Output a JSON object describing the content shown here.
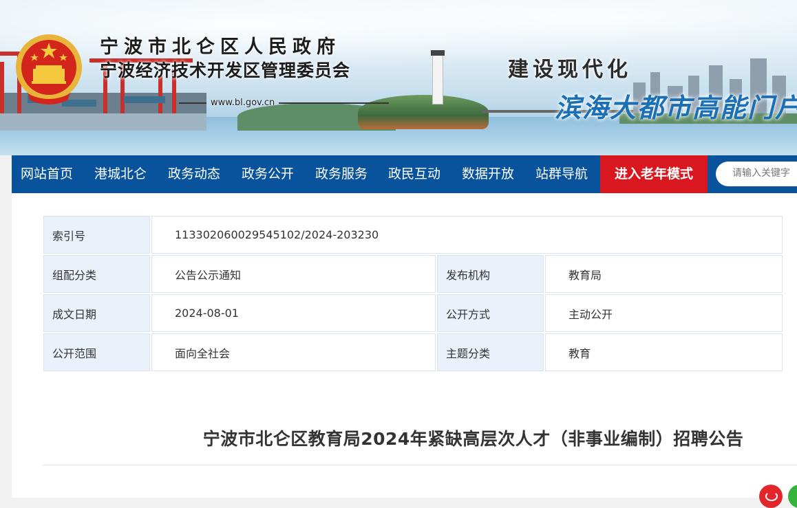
{
  "header": {
    "gov_title": "宁波市北仑区人民政府",
    "gov_subtitle": "宁波经济技术开发区管理委员会",
    "domain": "www.bl.gov.cn",
    "slogan_top": "建设现代化",
    "slogan_bottom": "滨海大都市高能门户",
    "emblem_icon": "national-emblem-icon"
  },
  "nav": {
    "items": [
      {
        "label": "网站首页"
      },
      {
        "label": "港城北仑"
      },
      {
        "label": "政务动态"
      },
      {
        "label": "政务公开"
      },
      {
        "label": "政务服务"
      },
      {
        "label": "政民互动"
      },
      {
        "label": "数据开放"
      },
      {
        "label": "站群导航"
      }
    ],
    "elder_mode": "进入老年模式",
    "search_placeholder": "请输入关键字"
  },
  "meta": {
    "index_label": "索引号",
    "index_value": "113302060029545102/2024-203230",
    "category_label": "组配分类",
    "category_value": "公告公示通知",
    "publisher_label": "发布机构",
    "publisher_value": "教育局",
    "date_label": "成文日期",
    "date_value": "2024-08-01",
    "open_method_label": "公开方式",
    "open_method_value": "主动公开",
    "scope_label": "公开范围",
    "scope_value": "面向全社会",
    "topic_label": "主题分类",
    "topic_value": "教育"
  },
  "article": {
    "title": "宁波市北仑区教育局2024年紧缺高层次人才（非事业编制）招聘公告"
  },
  "colors": {
    "nav_bg": "#08539b",
    "elder_bg": "#d8181e",
    "meta_label_bg": "#eaf1fa"
  }
}
